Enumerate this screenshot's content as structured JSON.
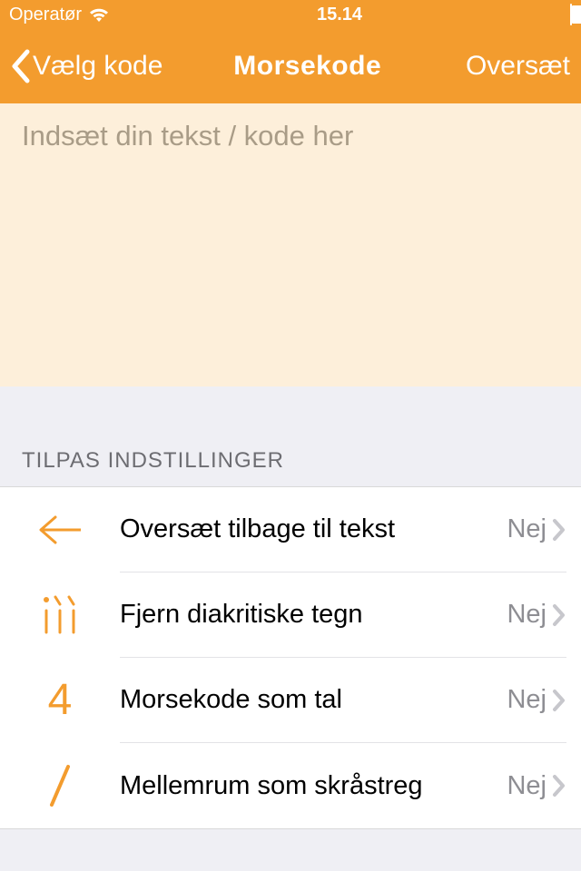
{
  "status": {
    "carrier": "Operatør",
    "time": "15.14"
  },
  "nav": {
    "back_label": "Vælg kode",
    "title": "Morsekode",
    "action": "Oversæt"
  },
  "input": {
    "placeholder": "Indsæt din tekst / kode her"
  },
  "section_header": "TILPAS INDSTILLINGER",
  "settings": [
    {
      "label": "Oversæt tilbage til tekst",
      "value": "Nej",
      "icon": "arrow-back"
    },
    {
      "label": "Fjern diakritiske tegn",
      "value": "Nej",
      "icon": "diacritics"
    },
    {
      "label": "Morsekode som tal",
      "value": "Nej",
      "icon": "number4"
    },
    {
      "label": "Mellemrum som skråstreg",
      "value": "Nej",
      "icon": "slash"
    }
  ]
}
